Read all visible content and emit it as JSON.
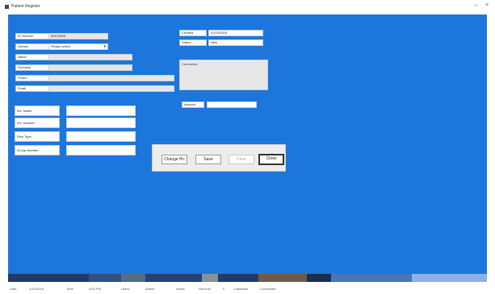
{
  "window": {
    "title": "Patient Register",
    "minimize": "–",
    "close": "×"
  },
  "form": {
    "left": [
      {
        "label": "ID Number",
        "value": "00123456"
      },
      {
        "label": "Gender",
        "value": "Please select"
      },
      {
        "label": "Name",
        "value": ""
      },
      {
        "label": "Surname",
        "value": ""
      },
      {
        "label": "Phone",
        "value": ""
      },
      {
        "label": "Email",
        "value": ""
      }
    ],
    "right": [
      {
        "label": "Created",
        "value": "01/10/2018"
      },
      {
        "label": "Status",
        "value": "New"
      }
    ],
    "comment_label": "Comment",
    "comment_value": "Comments",
    "extra": {
      "label": "Amount",
      "value": ""
    },
    "lower": [
      {
        "label": "Ins. Name",
        "value": ""
      },
      {
        "label": "Ins. Number",
        "value": ""
      },
      {
        "label": "Plan Type",
        "value": ""
      },
      {
        "label": "Group Number",
        "value": ""
      }
    ]
  },
  "buttons": {
    "change": "Change Pic",
    "save": "Save",
    "clear": "Clear",
    "close": "Close"
  },
  "statusbar": [
    "Date",
    "1/10/2018",
    "Time",
    "4:52 PM",
    "Users",
    "Admin",
    "Active",
    "Records",
    "0",
    "Database",
    "Connected"
  ],
  "colors": {
    "main": "#1d76db"
  }
}
